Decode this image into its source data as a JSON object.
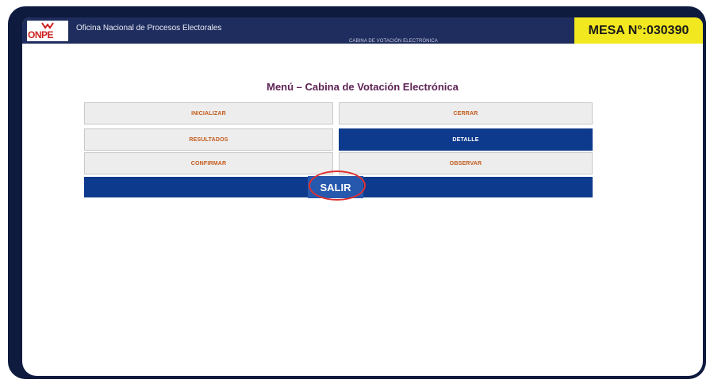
{
  "header": {
    "logo_text": "ONPE",
    "org_name": "Oficina Nacional de Procesos Electorales",
    "subtitle": "CABINA DE VOTACIÓN ELECTRÓNICA",
    "mesa_label": "MESA N°:030390"
  },
  "menu": {
    "title": "Menú – Cabina de Votación Electrónica",
    "buttons": {
      "inicializar": "INICIALIZAR",
      "cerrar": "CERRAR",
      "resultados": "RESULTADOS",
      "detalle": "DETALLE",
      "confirmar": "CONFIRMAR",
      "observar": "OBSERVAR"
    },
    "salir": "SALIR"
  },
  "colors": {
    "frame": "#0e1a3e",
    "topbar": "#1f2d5e",
    "mesa_bg": "#f2e81f",
    "active_button": "#0d3a8c",
    "button_text": "#c45a1a",
    "title_text": "#5e2355",
    "highlight_circle": "#e03131"
  }
}
